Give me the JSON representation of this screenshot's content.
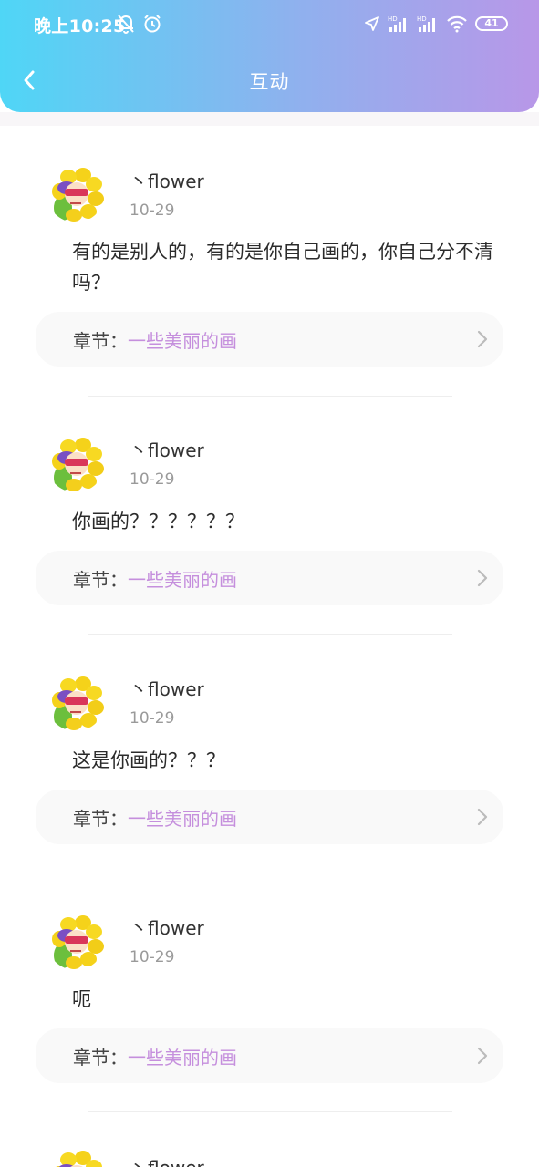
{
  "status_bar": {
    "time": "晚上10:25",
    "battery": "41"
  },
  "header": {
    "title": "互动"
  },
  "chapter_label": "章节：",
  "items": [
    {
      "username": "丶flower",
      "date": "10-29",
      "content": "有的是别人的，有的是你自己画的，你自己分不清吗？",
      "chapter": "一些美丽的画"
    },
    {
      "username": "丶flower",
      "date": "10-29",
      "content": "你画的？？？？？？",
      "chapter": "一些美丽的画"
    },
    {
      "username": "丶flower",
      "date": "10-29",
      "content": "这是你画的？？？",
      "chapter": "一些美丽的画"
    },
    {
      "username": "丶flower",
      "date": "10-29",
      "content": "呃",
      "chapter": "一些美丽的画"
    },
    {
      "username": "丶flower"
    }
  ],
  "colors": {
    "header_start": "#4fd6f6",
    "header_end": "#b897e8",
    "chapter_accent": "#c58fdd"
  }
}
